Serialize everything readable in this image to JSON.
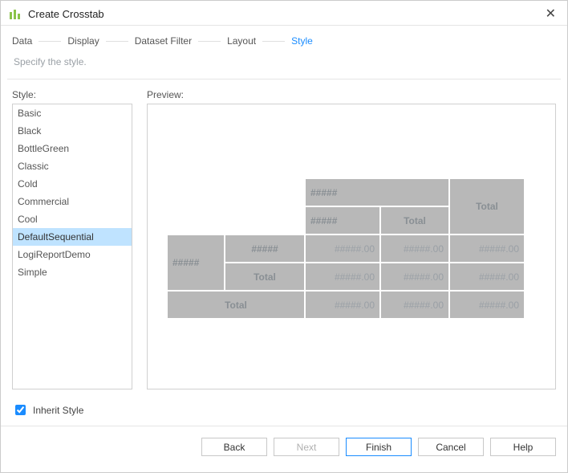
{
  "window": {
    "title": "Create Crosstab"
  },
  "steps": {
    "data": "Data",
    "display": "Display",
    "dataset_filter": "Dataset Filter",
    "layout": "Layout",
    "style": "Style",
    "active": "style"
  },
  "subtitle": "Specify the style.",
  "section": {
    "style_label": "Style:",
    "preview_label": "Preview:"
  },
  "styles": [
    "Basic",
    "Black",
    "BottleGreen",
    "Classic",
    "Cold",
    "Commercial",
    "Cool",
    "DefaultSequential",
    "LogiReportDemo",
    "Simple"
  ],
  "selected_style_index": 7,
  "preview": {
    "placeholder_text": "#####",
    "total_text": "Total",
    "value_text": "#####.00"
  },
  "inherit": {
    "label": "Inherit Style",
    "checked": true
  },
  "buttons": {
    "back": "Back",
    "next": "Next",
    "finish": "Finish",
    "cancel": "Cancel",
    "help": "Help"
  }
}
